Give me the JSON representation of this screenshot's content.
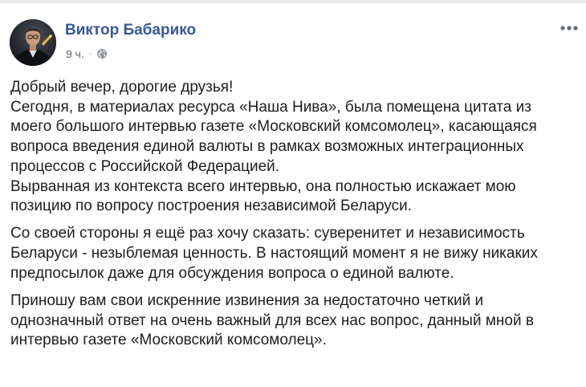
{
  "post": {
    "author": {
      "name": "Виктор Бабарико",
      "avatar_icon": "profile-photo"
    },
    "timestamp": "9 ч.",
    "meta_separator": "·",
    "privacy_icon": "globe-icon",
    "menu_icon": "more-options-icon",
    "paragraphs": [
      {
        "lines": [
          "Добрый вечер, дорогие друзья!",
          "Сегодня, в материалах ресурса «Наша Нива», была помещена цитата из",
          "моего большого интервью газете «Московский комсомолец», касающаяся",
          "вопроса введения единой валюты в рамках возможных интеграционных",
          "процессов с Российской Федерацией.",
          "Вырванная из контекста всего интервью, она полностью искажает мою",
          "позицию по вопросу построения независимой Беларуси."
        ]
      },
      {
        "lines": [
          "Со своей стороны я ещё раз хочу сказать: суверенитет и независимость",
          "Беларуси - незыблемая ценность. В настоящий момент я не вижу никаких",
          "предпосылок даже для обсуждения вопроса о единой валюте."
        ]
      },
      {
        "lines": [
          "Приношу вам свои искренние извинения за недостаточно четкий и",
          "однозначный ответ на очень важный для всех нас вопрос, данный мной в",
          "интервью газете «Московский комсомолец»."
        ]
      }
    ]
  },
  "colors": {
    "author_link": "#365899",
    "body_text": "#1c1e21",
    "meta_text": "#616770"
  }
}
